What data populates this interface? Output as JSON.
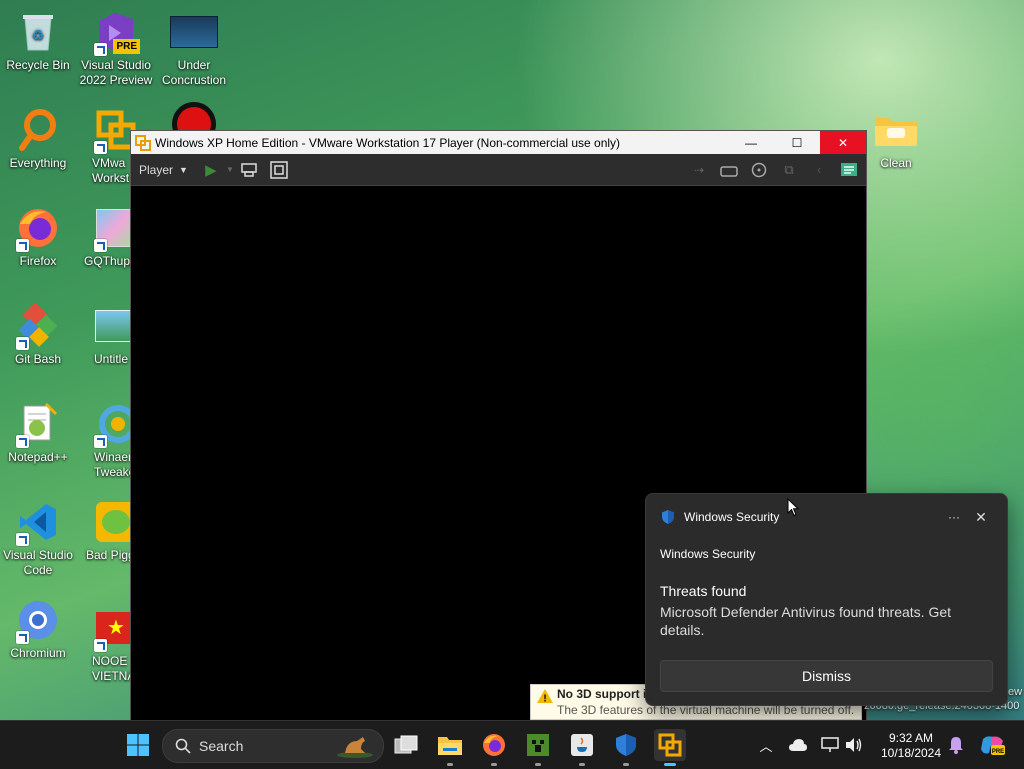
{
  "desktop": {
    "icons": [
      {
        "id": "recycle-bin",
        "label": "Recycle Bin"
      },
      {
        "id": "visual-studio-2022",
        "label": "Visual Studio 2022 Preview",
        "badge": "PRE"
      },
      {
        "id": "under-concrustion",
        "label": "Under Concrustion"
      },
      {
        "id": "everything",
        "label": "Everything"
      },
      {
        "id": "vmware-workstation",
        "label": "VMwa Workst"
      },
      {
        "id": "firefox",
        "label": "Firefox"
      },
      {
        "id": "gqthupp",
        "label": "GQThupp"
      },
      {
        "id": "git-bash",
        "label": "Git Bash"
      },
      {
        "id": "untitled",
        "label": "Untitle"
      },
      {
        "id": "notepadpp",
        "label": "Notepad++"
      },
      {
        "id": "winaero-tweaker",
        "label": "Winaer Tweake"
      },
      {
        "id": "vscode",
        "label": "Visual Studio Code"
      },
      {
        "id": "bad-piggies",
        "label": "Bad Pigg"
      },
      {
        "id": "chromium",
        "label": "Chromium"
      },
      {
        "id": "noob-vietnam",
        "label": "NOOE VIETNA"
      },
      {
        "id": "clean",
        "label": "Clean"
      }
    ]
  },
  "vmware": {
    "title": "Windows XP Home Edition - VMware Workstation 17 Player (Non-commercial use only)",
    "player_menu": "Player"
  },
  "toast": {
    "app_name": "Windows Security",
    "source": "Windows Security",
    "heading": "Threats found",
    "body": "Microsoft Defender Antivirus found threats. Get details.",
    "dismiss": "Dismiss"
  },
  "notice": {
    "title": "No 3D support i",
    "text": "The 3D features of the virtual machine will be turned off."
  },
  "build_text": "z6080.ge_release.240308-1400",
  "build_text2": "ew",
  "taskbar": {
    "search_placeholder": "Search",
    "time": "9:32 AM",
    "date": "10/18/2024"
  },
  "colors": {
    "accent": "#4cc2ff",
    "close_red": "#e81123",
    "taskbar_bg": "#1c1c1c",
    "toast_bg": "#2b2b2b"
  }
}
